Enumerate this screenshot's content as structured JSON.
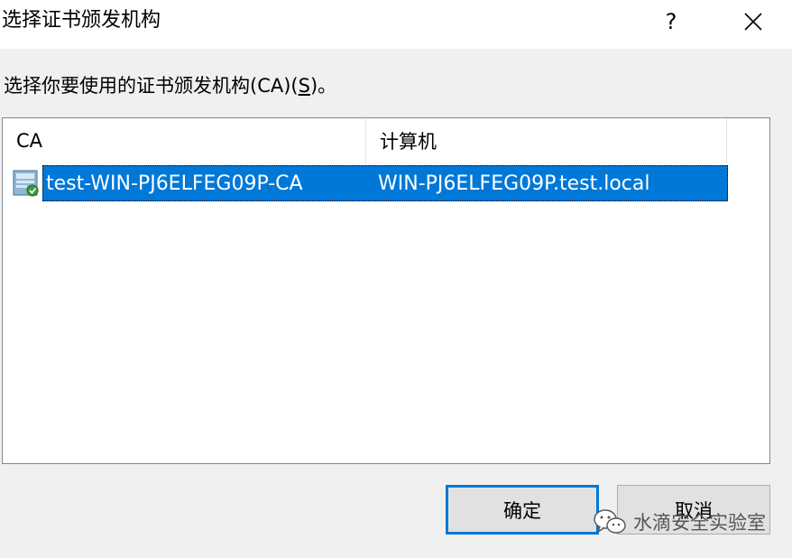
{
  "window": {
    "title": "选择证书颁发机构",
    "help_label": "?",
    "close_icon": "close-icon"
  },
  "instruction": {
    "prefix": "选择你要使用的证书颁发机构(CA)(",
    "mnemonic": "S",
    "suffix": ")。"
  },
  "list": {
    "columns": [
      "CA",
      "计算机"
    ],
    "rows": [
      {
        "icon": "certificate-authority-icon",
        "ca": "test-WIN-PJ6ELFEG09P-CA",
        "computer": "WIN-PJ6ELFEG09P.test.local",
        "selected": true
      }
    ]
  },
  "buttons": {
    "ok": "确定",
    "cancel": "取消"
  },
  "watermark": {
    "icon": "wechat-icon",
    "text": "水滴安全实验室"
  },
  "colors": {
    "selection": "#0078d7",
    "default_button_border": "#0078d7",
    "title_bar": "#ffffff",
    "dialog_bg": "#f0f0f0"
  }
}
